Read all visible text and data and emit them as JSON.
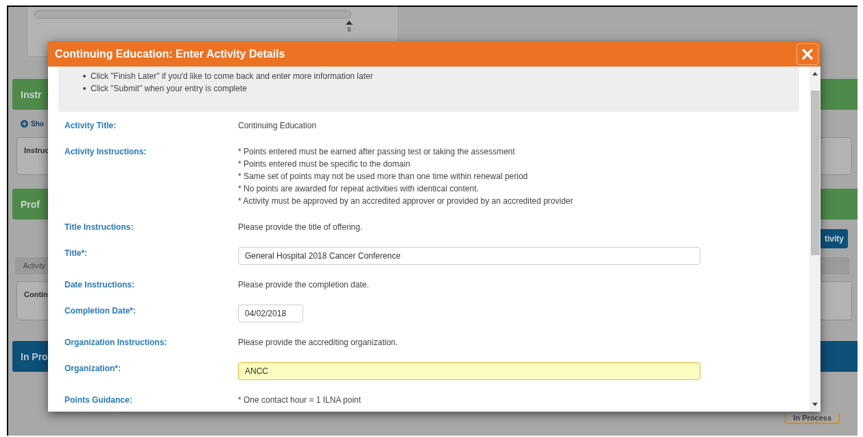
{
  "background": {
    "slider_tick": "8",
    "instructions_header": "Instr",
    "show_link": "Sho",
    "instructions_card": "Instruc",
    "profile_header": "Prof",
    "add_button": "tivity",
    "table_header": "Activity",
    "activity_card": "Contin",
    "in_process_header": "In Pro",
    "status_button": "In Process"
  },
  "dialog": {
    "title": "Continuing Education: Enter Activity Details",
    "notes": [
      "Click \"Finish Later\" if you'd like to come back and enter more information later",
      "Click \"Submit\" when your entry is complete"
    ],
    "rows": [
      {
        "kind": "text",
        "label": "Activity Title:",
        "lines": [
          "Continuing Education"
        ]
      },
      {
        "kind": "text",
        "label": "Activity Instructions:",
        "lines": [
          "* Points entered must be earned after passing test or taking the assessment",
          "* Points entered must be specific to the domain",
          "* Same set of points may not be used more than one time within renewal period",
          "* No points are awarded for repeat activities with identical content.",
          "* Activity must be approved by an accredited approver or provided by an accredited provider"
        ]
      },
      {
        "kind": "text",
        "label": "Title Instructions:",
        "lines": [
          "Please provide the title of offering."
        ]
      },
      {
        "kind": "wide_input",
        "label": "Title*:",
        "value": "General Hospital 2018 Cancer Conference",
        "focused": false
      },
      {
        "kind": "text",
        "label": "Date Instructions:",
        "lines": [
          "Please provide the completion date."
        ]
      },
      {
        "kind": "date_input",
        "label": "Completion Date*:",
        "value": "04/02/2018",
        "focused": false
      },
      {
        "kind": "text",
        "label": "Organization Instructions:",
        "lines": [
          "Please provide the accrediting organization."
        ]
      },
      {
        "kind": "wide_input",
        "label": "Organization*:",
        "value": "ANCC",
        "focused": true
      },
      {
        "kind": "text",
        "label": "Points Guidance:",
        "lines": [
          "* One contact hour = 1 ILNA point"
        ]
      }
    ]
  }
}
